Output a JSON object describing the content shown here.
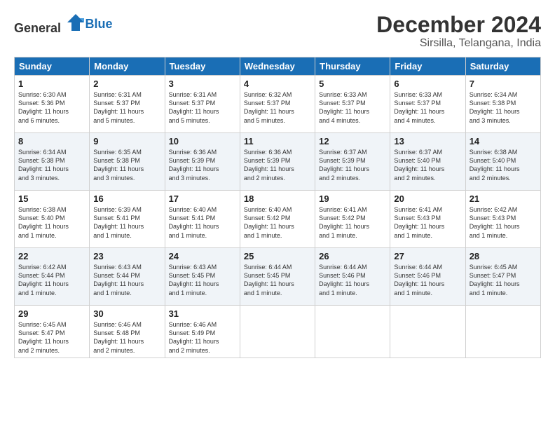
{
  "header": {
    "logo_general": "General",
    "logo_blue": "Blue",
    "month": "December 2024",
    "location": "Sirsilla, Telangana, India"
  },
  "days_of_week": [
    "Sunday",
    "Monday",
    "Tuesday",
    "Wednesday",
    "Thursday",
    "Friday",
    "Saturday"
  ],
  "weeks": [
    [
      {
        "day": "1",
        "lines": [
          "Sunrise: 6:30 AM",
          "Sunset: 5:36 PM",
          "Daylight: 11 hours",
          "and 6 minutes."
        ]
      },
      {
        "day": "2",
        "lines": [
          "Sunrise: 6:31 AM",
          "Sunset: 5:37 PM",
          "Daylight: 11 hours",
          "and 5 minutes."
        ]
      },
      {
        "day": "3",
        "lines": [
          "Sunrise: 6:31 AM",
          "Sunset: 5:37 PM",
          "Daylight: 11 hours",
          "and 5 minutes."
        ]
      },
      {
        "day": "4",
        "lines": [
          "Sunrise: 6:32 AM",
          "Sunset: 5:37 PM",
          "Daylight: 11 hours",
          "and 5 minutes."
        ]
      },
      {
        "day": "5",
        "lines": [
          "Sunrise: 6:33 AM",
          "Sunset: 5:37 PM",
          "Daylight: 11 hours",
          "and 4 minutes."
        ]
      },
      {
        "day": "6",
        "lines": [
          "Sunrise: 6:33 AM",
          "Sunset: 5:37 PM",
          "Daylight: 11 hours",
          "and 4 minutes."
        ]
      },
      {
        "day": "7",
        "lines": [
          "Sunrise: 6:34 AM",
          "Sunset: 5:38 PM",
          "Daylight: 11 hours",
          "and 3 minutes."
        ]
      }
    ],
    [
      {
        "day": "8",
        "lines": [
          "Sunrise: 6:34 AM",
          "Sunset: 5:38 PM",
          "Daylight: 11 hours",
          "and 3 minutes."
        ]
      },
      {
        "day": "9",
        "lines": [
          "Sunrise: 6:35 AM",
          "Sunset: 5:38 PM",
          "Daylight: 11 hours",
          "and 3 minutes."
        ]
      },
      {
        "day": "10",
        "lines": [
          "Sunrise: 6:36 AM",
          "Sunset: 5:39 PM",
          "Daylight: 11 hours",
          "and 3 minutes."
        ]
      },
      {
        "day": "11",
        "lines": [
          "Sunrise: 6:36 AM",
          "Sunset: 5:39 PM",
          "Daylight: 11 hours",
          "and 2 minutes."
        ]
      },
      {
        "day": "12",
        "lines": [
          "Sunrise: 6:37 AM",
          "Sunset: 5:39 PM",
          "Daylight: 11 hours",
          "and 2 minutes."
        ]
      },
      {
        "day": "13",
        "lines": [
          "Sunrise: 6:37 AM",
          "Sunset: 5:40 PM",
          "Daylight: 11 hours",
          "and 2 minutes."
        ]
      },
      {
        "day": "14",
        "lines": [
          "Sunrise: 6:38 AM",
          "Sunset: 5:40 PM",
          "Daylight: 11 hours",
          "and 2 minutes."
        ]
      }
    ],
    [
      {
        "day": "15",
        "lines": [
          "Sunrise: 6:38 AM",
          "Sunset: 5:40 PM",
          "Daylight: 11 hours",
          "and 1 minute."
        ]
      },
      {
        "day": "16",
        "lines": [
          "Sunrise: 6:39 AM",
          "Sunset: 5:41 PM",
          "Daylight: 11 hours",
          "and 1 minute."
        ]
      },
      {
        "day": "17",
        "lines": [
          "Sunrise: 6:40 AM",
          "Sunset: 5:41 PM",
          "Daylight: 11 hours",
          "and 1 minute."
        ]
      },
      {
        "day": "18",
        "lines": [
          "Sunrise: 6:40 AM",
          "Sunset: 5:42 PM",
          "Daylight: 11 hours",
          "and 1 minute."
        ]
      },
      {
        "day": "19",
        "lines": [
          "Sunrise: 6:41 AM",
          "Sunset: 5:42 PM",
          "Daylight: 11 hours",
          "and 1 minute."
        ]
      },
      {
        "day": "20",
        "lines": [
          "Sunrise: 6:41 AM",
          "Sunset: 5:43 PM",
          "Daylight: 11 hours",
          "and 1 minute."
        ]
      },
      {
        "day": "21",
        "lines": [
          "Sunrise: 6:42 AM",
          "Sunset: 5:43 PM",
          "Daylight: 11 hours",
          "and 1 minute."
        ]
      }
    ],
    [
      {
        "day": "22",
        "lines": [
          "Sunrise: 6:42 AM",
          "Sunset: 5:44 PM",
          "Daylight: 11 hours",
          "and 1 minute."
        ]
      },
      {
        "day": "23",
        "lines": [
          "Sunrise: 6:43 AM",
          "Sunset: 5:44 PM",
          "Daylight: 11 hours",
          "and 1 minute."
        ]
      },
      {
        "day": "24",
        "lines": [
          "Sunrise: 6:43 AM",
          "Sunset: 5:45 PM",
          "Daylight: 11 hours",
          "and 1 minute."
        ]
      },
      {
        "day": "25",
        "lines": [
          "Sunrise: 6:44 AM",
          "Sunset: 5:45 PM",
          "Daylight: 11 hours",
          "and 1 minute."
        ]
      },
      {
        "day": "26",
        "lines": [
          "Sunrise: 6:44 AM",
          "Sunset: 5:46 PM",
          "Daylight: 11 hours",
          "and 1 minute."
        ]
      },
      {
        "day": "27",
        "lines": [
          "Sunrise: 6:44 AM",
          "Sunset: 5:46 PM",
          "Daylight: 11 hours",
          "and 1 minute."
        ]
      },
      {
        "day": "28",
        "lines": [
          "Sunrise: 6:45 AM",
          "Sunset: 5:47 PM",
          "Daylight: 11 hours",
          "and 1 minute."
        ]
      }
    ],
    [
      {
        "day": "29",
        "lines": [
          "Sunrise: 6:45 AM",
          "Sunset: 5:47 PM",
          "Daylight: 11 hours",
          "and 2 minutes."
        ]
      },
      {
        "day": "30",
        "lines": [
          "Sunrise: 6:46 AM",
          "Sunset: 5:48 PM",
          "Daylight: 11 hours",
          "and 2 minutes."
        ]
      },
      {
        "day": "31",
        "lines": [
          "Sunrise: 6:46 AM",
          "Sunset: 5:49 PM",
          "Daylight: 11 hours",
          "and 2 minutes."
        ]
      },
      {
        "day": "",
        "lines": []
      },
      {
        "day": "",
        "lines": []
      },
      {
        "day": "",
        "lines": []
      },
      {
        "day": "",
        "lines": []
      }
    ]
  ]
}
